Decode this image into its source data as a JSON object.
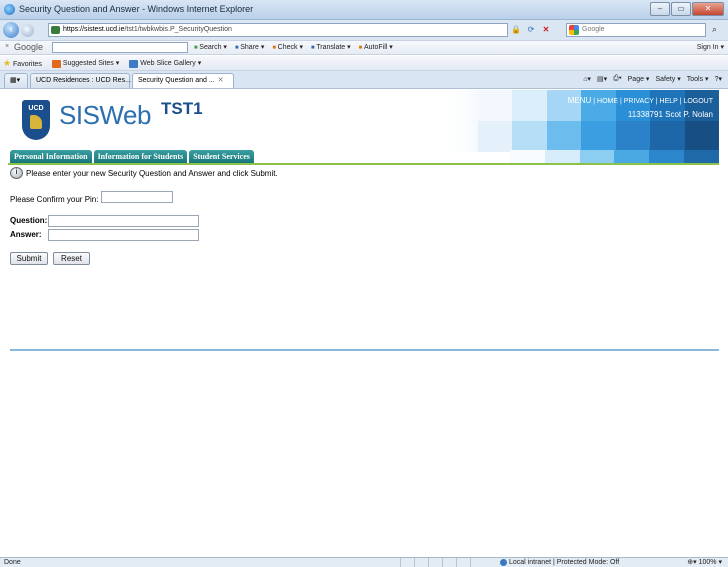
{
  "window": {
    "title": "Security Question and Answer - Windows Internet Explorer",
    "controls": [
      "–",
      "▭",
      "✕"
    ]
  },
  "address_bar": {
    "url_host": "https://sistest.ucd.ie",
    "url_path": "/tst1/twbkwbis.P_SecurityQuestion",
    "search_placeholder": "Google"
  },
  "google_toolbar": {
    "logo": "Google",
    "items": [
      "Search ▾",
      "Share ▾",
      "Check ▾",
      "Translate ▾",
      "AutoFill ▾"
    ],
    "sign_in": "Sign In ▾"
  },
  "favorites_bar": {
    "favorites": "Favorites",
    "suggested_sites": "Suggested Sites ▾",
    "web_slice": "Web Slice Gallery ▾"
  },
  "tabs": [
    {
      "label": "UCD Residences : UCD Res..."
    },
    {
      "label": "Security Question and ...",
      "close": "✕"
    }
  ],
  "command_bar": [
    "Page ▾",
    "Safety ▾",
    "Tools ▾"
  ],
  "site": {
    "crest_text": "UCD",
    "crest_subtext": "DUBLIN",
    "logo": "SISWeb",
    "environment": "TST1",
    "links": {
      "menu": "MENU",
      "home": "HOME",
      "privacy": "PRIVACY",
      "help": "HELP",
      "logout": "LOGOUT",
      "sep": " | "
    },
    "user": "11338791 Scot P. Nolan",
    "nav_tabs": [
      "Personal Information",
      "Information for Students",
      "Student Services"
    ],
    "colors": {
      "nav_tab": "#16777a",
      "nav_line": "#8dc24a",
      "brand_blue": "#1a4e8c"
    }
  },
  "form": {
    "instruction": "Please enter your new Security Question and Answer and click Submit.",
    "pin_label": "Please Confirm your Pin:",
    "pin_value": "",
    "question_label": "Question:",
    "question_value": "",
    "answer_label": "Answer:",
    "answer_value": "",
    "submit": "Submit",
    "reset": "Reset"
  },
  "status_bar": {
    "status": "Done",
    "zone": "Local intranet | Protected Mode: Off",
    "zoom": "100%"
  }
}
